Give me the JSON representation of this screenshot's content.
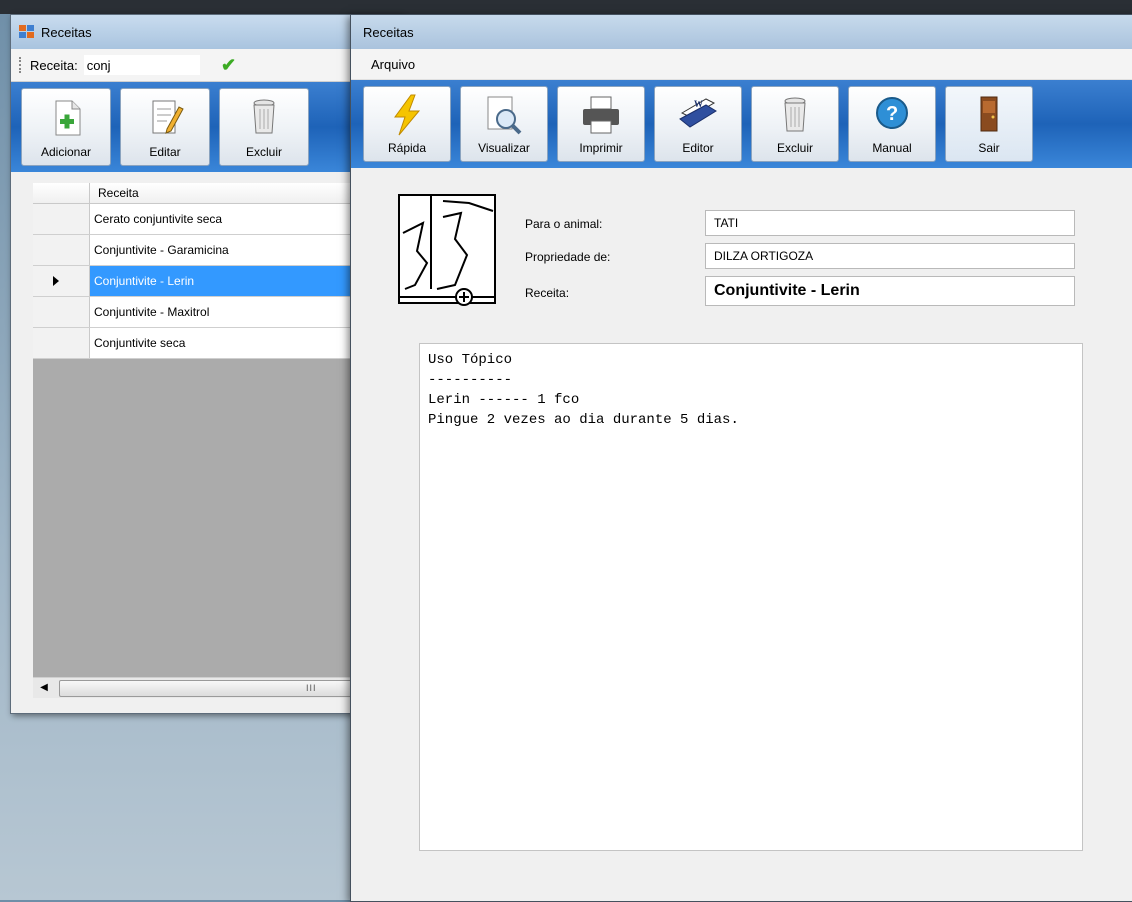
{
  "back_window": {
    "title": "Receitas",
    "search": {
      "label": "Receita:",
      "value": "conj"
    },
    "toolbar": [
      {
        "label": "Adicionar",
        "icon": "add-document-icon"
      },
      {
        "label": "Editar",
        "icon": "edit-document-icon"
      },
      {
        "label": "Excluir",
        "icon": "trash-can-icon"
      }
    ],
    "grid": {
      "column_header": "Receita",
      "rows": [
        {
          "label": "Cerato conjuntivite seca",
          "selected": false
        },
        {
          "label": "Conjuntivite - Garamicina",
          "selected": false
        },
        {
          "label": "Conjuntivite - Lerin",
          "selected": true
        },
        {
          "label": "Conjuntivite - Maxitrol",
          "selected": false
        },
        {
          "label": "Conjuntivite seca",
          "selected": false
        }
      ]
    }
  },
  "front_window": {
    "title": "Receitas",
    "menu": {
      "arquivo": "Arquivo"
    },
    "toolbar": [
      {
        "label": "Rápida",
        "icon": "lightning-icon"
      },
      {
        "label": "Visualizar",
        "icon": "preview-magnifier-icon"
      },
      {
        "label": "Imprimir",
        "icon": "printer-icon"
      },
      {
        "label": "Editor",
        "icon": "word-editor-icon"
      },
      {
        "label": "Excluir",
        "icon": "trash-can-icon"
      },
      {
        "label": "Manual",
        "icon": "help-icon"
      },
      {
        "label": "Sair",
        "icon": "exit-door-icon"
      }
    ],
    "fields": {
      "animal_label": "Para o animal:",
      "animal_value": "TATI",
      "owner_label": "Propriedade de:",
      "owner_value": "DILZA ORTIGOZA",
      "recipe_label": "Receita:",
      "recipe_value": "Conjuntivite - Lerin"
    },
    "prescription_lines": [
      "Uso Tópico",
      "----------",
      "Lerin ------ 1 fco",
      "Pingue 2 vezes ao dia durante 5 dias."
    ]
  },
  "colors": {
    "toolbar_blue": "#1e63b8",
    "selection_blue": "#3399ff",
    "check_green": "#3cab24"
  }
}
